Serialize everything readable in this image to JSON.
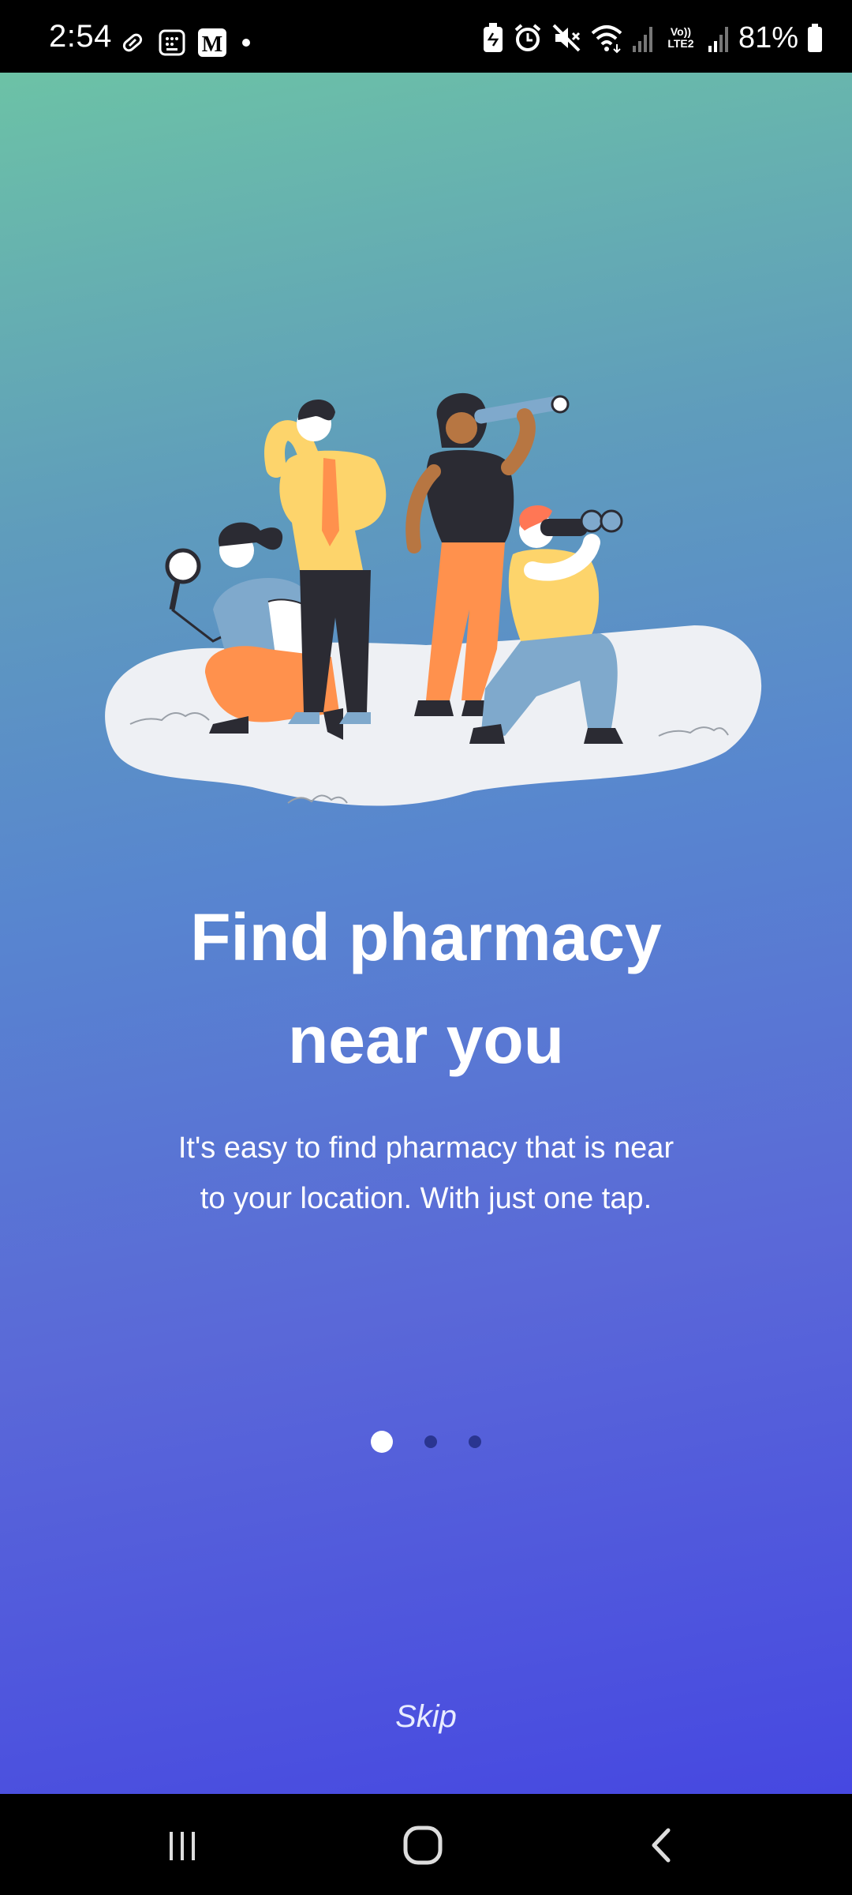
{
  "status_bar": {
    "time": "2:54",
    "battery_text": "81%",
    "volte_line1": "Vo))",
    "volte_line2": "LTE2",
    "icons_left": [
      "pill-icon",
      "calculator-icon",
      "m-app-icon",
      "dot-icon"
    ],
    "icons_right": [
      "battery-saver-icon",
      "alarm-icon",
      "mute-icon",
      "wifi-icon",
      "signal-icon",
      "signal-icon-2",
      "battery-icon"
    ]
  },
  "onboarding": {
    "title_line1": "Find pharmacy",
    "title_line2": "near you",
    "description": "It's easy to find pharmacy that is near to your location. With just one tap.",
    "page_indicator": {
      "current": 1,
      "total": 3
    },
    "skip_label": "Skip",
    "illustration": "people-searching-illustration"
  },
  "nav_bar": {
    "buttons": [
      "recents-button",
      "home-button",
      "back-button"
    ]
  },
  "colors": {
    "gradient_top": "#6cc2a6",
    "gradient_bottom": "#4648e1",
    "dot_inactive": "#2a3590",
    "dot_active": "#ffffff"
  }
}
